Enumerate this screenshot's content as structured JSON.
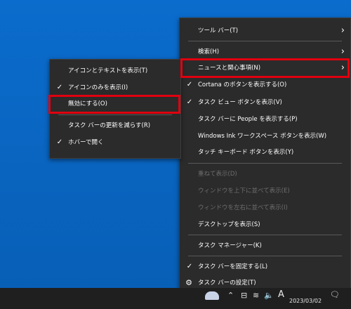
{
  "main_menu": {
    "items": [
      {
        "label": "ツール バー(T)",
        "submenu": true
      },
      {
        "label": "検索(H)",
        "submenu": true
      },
      {
        "label": "ニュースと関心事項(N)",
        "submenu": true
      },
      {
        "label": "Cortana のボタンを表示する(O)",
        "checked": true
      },
      {
        "label": "タスク ビュー ボタンを表示(V)",
        "checked": true
      },
      {
        "label": "タスク バーに People を表示する(P)"
      },
      {
        "label": "Windows Ink ワークスペース ボタンを表示(W)"
      },
      {
        "label": "タッチ キーボード ボタンを表示(Y)"
      },
      {
        "label": "重ねて表示(D)",
        "disabled": true
      },
      {
        "label": "ウィンドウを上下に並べて表示(E)",
        "disabled": true
      },
      {
        "label": "ウィンドウを左右に並べて表示(I)",
        "disabled": true
      },
      {
        "label": "デスクトップを表示(S)"
      },
      {
        "label": "タスク マネージャー(K)"
      },
      {
        "label": "タスク バーを固定する(L)",
        "checked": true
      },
      {
        "label": "タスク バーの設定(T)",
        "icon": "gear-icon"
      }
    ]
  },
  "sub_menu": {
    "items": [
      {
        "label": "アイコンとテキストを表示(T)"
      },
      {
        "label": "アイコンのみを表示(I)",
        "checked": true
      },
      {
        "label": "無効にする(O)"
      },
      {
        "label": "タスク バーの更新を減らす(R)"
      },
      {
        "label": "ホバーで開く",
        "checked": true
      }
    ]
  },
  "glyphs": {
    "check": "✓",
    "chevron": "›",
    "gear": "⚙"
  },
  "taskbar": {
    "tray_icons": {
      "up_arrow": "⌃",
      "network": "⊟",
      "wifi": "≋",
      "volume": "🔈",
      "ime": "A",
      "notifications": "🗨"
    },
    "date": "2023/03/02"
  },
  "colors": {
    "desktop": "#0a67c8",
    "menu_bg": "#2b2b2b",
    "highlight": "#e0000f",
    "taskbar": "#1f1f1f"
  }
}
